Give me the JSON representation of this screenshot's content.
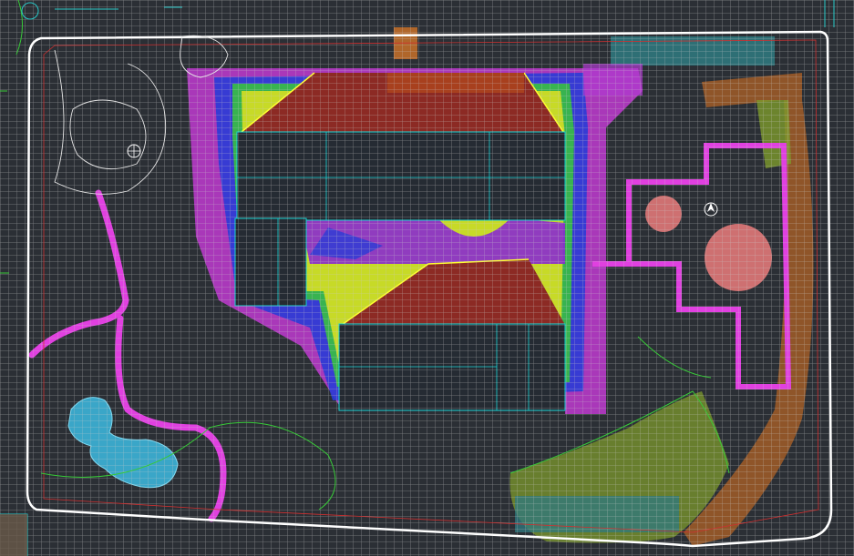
{
  "window": {
    "title": ""
  },
  "drawing": {
    "background": "#2b2f35",
    "grid_color": "#c8c8c8",
    "property_line_color": "#ffffff",
    "palette": {
      "roof_red": "#8c2a24",
      "roof_edge": "#ffff00",
      "building": "#252b33",
      "building_outline": "#19d6d6",
      "magenta": "#e040e0",
      "purple": "#8a2ad0",
      "blue": "#2a3cd6",
      "green": "#38c938",
      "yellow": "#e0e020",
      "pond": "#3aa6c8",
      "brown_path": "#9a5a28",
      "olive": "#8aa030",
      "salmon": "#e07878",
      "teal_paving": "#2f7a80",
      "gate_orange": "#b0662a"
    },
    "icons": [
      "tree-symbol-icon",
      "north-arrow-icon"
    ]
  },
  "annotations": {
    "pond_label": "",
    "patio_label": "",
    "lawn_label": ""
  }
}
